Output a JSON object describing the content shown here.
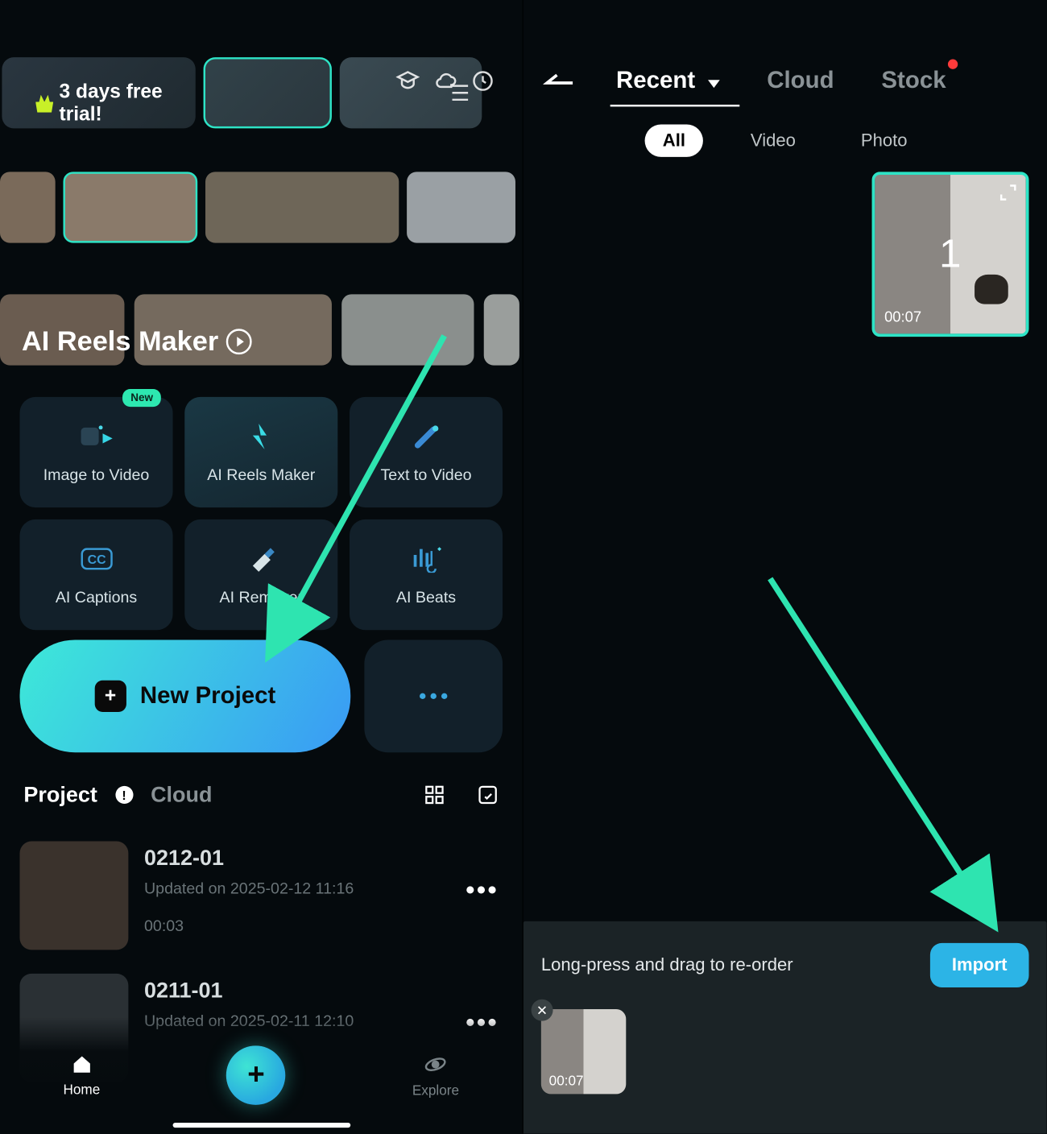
{
  "left": {
    "trial_badge": "3 days free trial!",
    "reels_title": "AI Reels Maker",
    "features": [
      {
        "label": "Image to Video",
        "badge": "New",
        "icon": "image-to-video-icon"
      },
      {
        "label": "AI Reels Maker",
        "icon": "ai-reels-icon",
        "highlight": true
      },
      {
        "label": "Text  to Video",
        "icon": "text-to-video-icon"
      },
      {
        "label": "AI Captions",
        "icon": "ai-captions-icon"
      },
      {
        "label": "AI Remover",
        "icon": "ai-remover-icon"
      },
      {
        "label": "AI Beats",
        "icon": "ai-beats-icon"
      }
    ],
    "new_project": "New Project",
    "projects_tab1": "Project",
    "projects_tab2": "Cloud",
    "projects": [
      {
        "name": "0212-01",
        "meta": "Updated on 2025-02-12 11:16",
        "dur": "00:03"
      },
      {
        "name": "0211-01",
        "meta": "Updated on 2025-02-11 12:10",
        "dur": ""
      }
    ],
    "nav": {
      "home": "Home",
      "explore": "Explore"
    }
  },
  "right": {
    "tabs": {
      "recent": "Recent",
      "cloud": "Cloud",
      "stock": "Stock"
    },
    "filters": {
      "all": "All",
      "video": "Video",
      "photo": "Photo"
    },
    "selected": {
      "num": "1",
      "dur": "00:07"
    },
    "sheet": {
      "hint": "Long-press and drag to re-order",
      "import": "Import",
      "thumb_dur": "00:07"
    }
  }
}
